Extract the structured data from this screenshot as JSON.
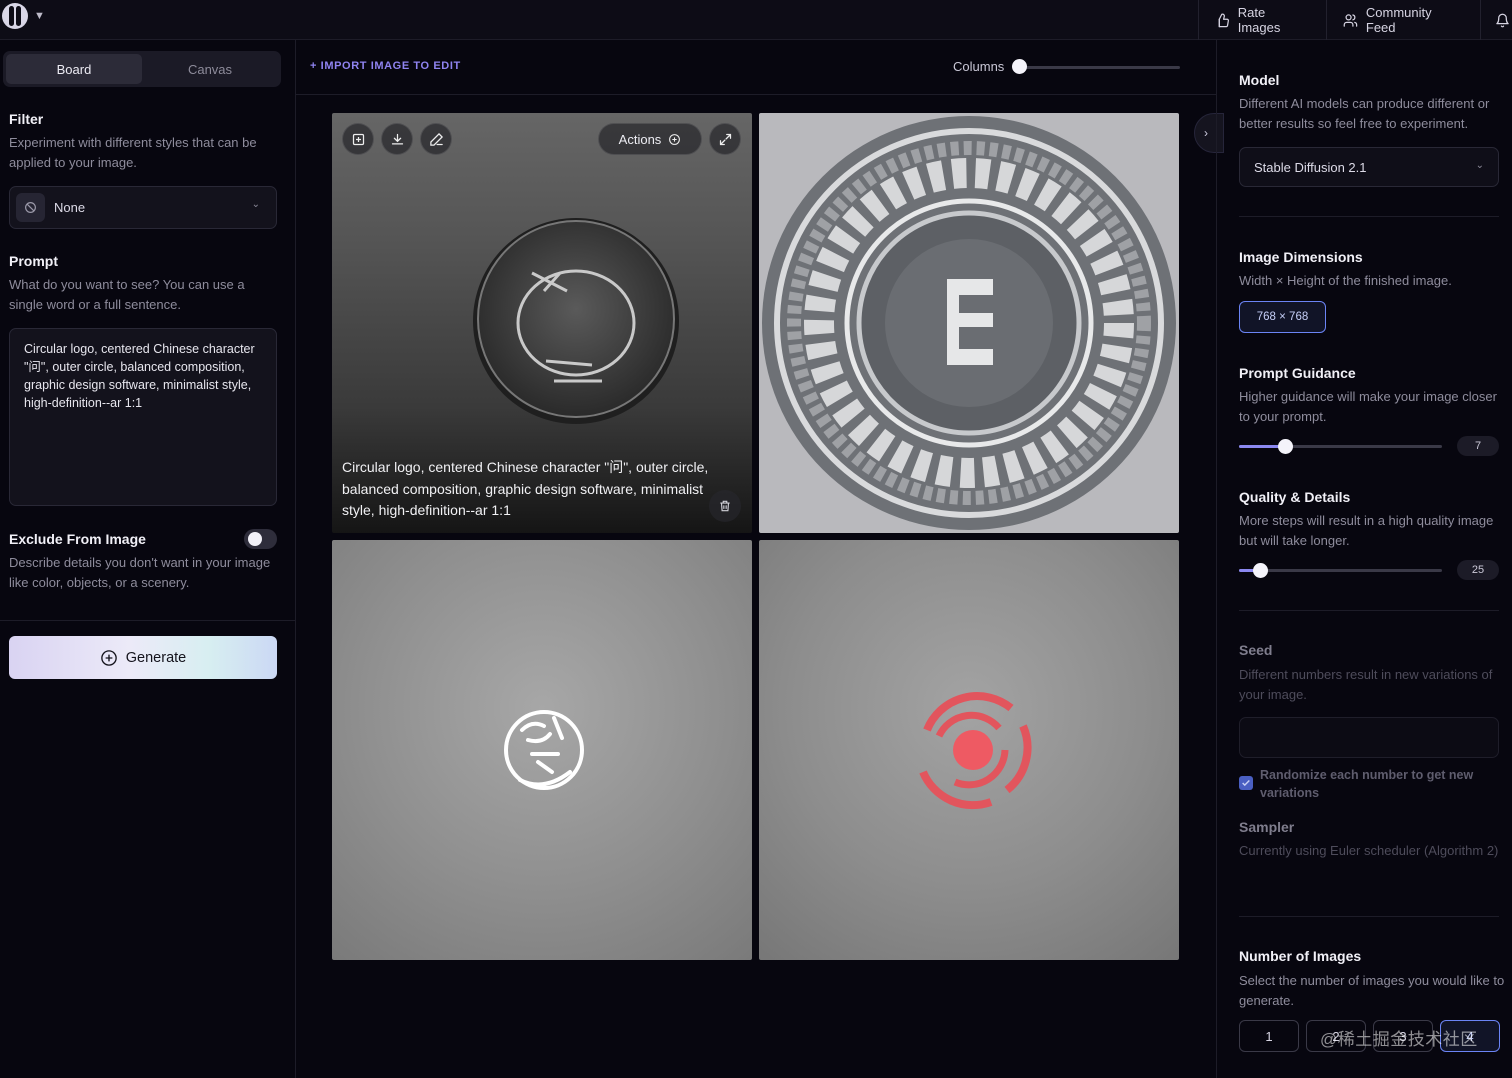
{
  "topbar": {
    "rate_label": "Rate Images",
    "feed_label": "Community Feed"
  },
  "left": {
    "tabs": [
      {
        "label": "Board",
        "active": true
      },
      {
        "label": "Canvas",
        "active": false
      }
    ],
    "filter": {
      "title": "Filter",
      "desc": "Experiment with different styles that can be applied to your image.",
      "value": "None"
    },
    "prompt": {
      "title": "Prompt",
      "desc": "What do you want to see? You can use a single word or a full sentence.",
      "value": "Circular logo, centered Chinese character \"问\", outer circle, balanced composition, graphic design software, minimalist style, high-definition--ar 1:1"
    },
    "exclude": {
      "title": "Exclude From Image",
      "desc": "Describe details you don't want in your image like color, objects, or a scenery.",
      "enabled": false
    },
    "generate_label": "Generate"
  },
  "center": {
    "import_label": "+ IMPORT IMAGE TO EDIT",
    "columns_label": "Columns",
    "actions_label": "Actions",
    "caption": "Circular logo, centered Chinese character \"问\", outer circle, balanced composition, graphic design software, minimalist style, high-definition--ar 1:1"
  },
  "right": {
    "model": {
      "title": "Model",
      "desc": "Different AI models can produce different or better results so feel free to experiment.",
      "value": "Stable Diffusion 2.1"
    },
    "dimensions": {
      "title": "Image Dimensions",
      "desc": "Width × Height of the finished image.",
      "value": "768 × 768"
    },
    "guidance": {
      "title": "Prompt Guidance",
      "desc": "Higher guidance will make your image closer to your prompt.",
      "value": "7"
    },
    "quality": {
      "title": "Quality & Details",
      "desc": "More steps will result in a high quality image but will take longer.",
      "value": "25"
    },
    "seed": {
      "title": "Seed",
      "desc": "Different numbers result in new variations of your image.",
      "randomize_label": "Randomize each number to get new variations",
      "randomize_checked": true
    },
    "sampler": {
      "title": "Sampler",
      "desc": "Currently using Euler scheduler (Algorithm 2)"
    },
    "num_images": {
      "title": "Number of Images",
      "desc": "Select the number of images you would like to generate.",
      "options": [
        "1",
        "2",
        "3",
        "4"
      ],
      "selected": "4"
    }
  },
  "watermark": "@稀土掘金技术社区"
}
